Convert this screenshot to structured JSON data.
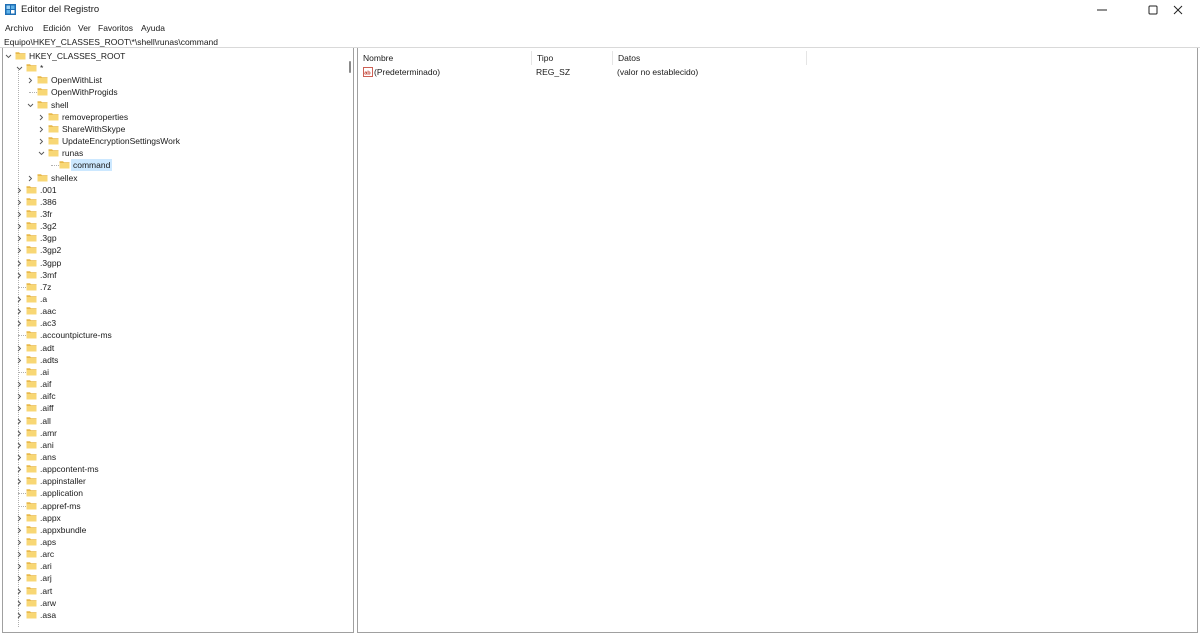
{
  "window": {
    "title": "Editor del Registro",
    "icon": "registry-editor-icon"
  },
  "menu": {
    "items": [
      "Archivo",
      "Edición",
      "Ver",
      "Favoritos",
      "Ayuda"
    ]
  },
  "address": {
    "path": "Equipo\\HKEY_CLASSES_ROOT\\*\\shell\\runas\\command"
  },
  "tree": {
    "rows": [
      {
        "label": "HKEY_CLASSES_ROOT",
        "level": 0,
        "state": "expanded"
      },
      {
        "label": "*",
        "level": 1,
        "state": "expanded"
      },
      {
        "label": "OpenWithList",
        "level": 2,
        "state": "collapsed"
      },
      {
        "label": "OpenWithProgids",
        "level": 2,
        "state": "leaf"
      },
      {
        "label": "shell",
        "level": 2,
        "state": "expanded"
      },
      {
        "label": "removeproperties",
        "level": 3,
        "state": "collapsed"
      },
      {
        "label": "ShareWithSkype",
        "level": 3,
        "state": "collapsed"
      },
      {
        "label": "UpdateEncryptionSettingsWork",
        "level": 3,
        "state": "collapsed"
      },
      {
        "label": "runas",
        "level": 3,
        "state": "expanded"
      },
      {
        "label": "command",
        "level": 4,
        "state": "selected"
      },
      {
        "label": "shellex",
        "level": 2,
        "state": "collapsed"
      },
      {
        "label": ".001",
        "level": 1,
        "state": "collapsed"
      },
      {
        "label": ".386",
        "level": 1,
        "state": "collapsed"
      },
      {
        "label": ".3fr",
        "level": 1,
        "state": "collapsed"
      },
      {
        "label": ".3g2",
        "level": 1,
        "state": "collapsed"
      },
      {
        "label": ".3gp",
        "level": 1,
        "state": "collapsed"
      },
      {
        "label": ".3gp2",
        "level": 1,
        "state": "collapsed"
      },
      {
        "label": ".3gpp",
        "level": 1,
        "state": "collapsed"
      },
      {
        "label": ".3mf",
        "level": 1,
        "state": "collapsed"
      },
      {
        "label": ".7z",
        "level": 1,
        "state": "leaf"
      },
      {
        "label": ".a",
        "level": 1,
        "state": "collapsed"
      },
      {
        "label": ".aac",
        "level": 1,
        "state": "collapsed"
      },
      {
        "label": ".ac3",
        "level": 1,
        "state": "collapsed"
      },
      {
        "label": ".accountpicture-ms",
        "level": 1,
        "state": "leaf"
      },
      {
        "label": ".adt",
        "level": 1,
        "state": "collapsed"
      },
      {
        "label": ".adts",
        "level": 1,
        "state": "collapsed"
      },
      {
        "label": ".ai",
        "level": 1,
        "state": "leaf"
      },
      {
        "label": ".aif",
        "level": 1,
        "state": "collapsed"
      },
      {
        "label": ".aifc",
        "level": 1,
        "state": "collapsed"
      },
      {
        "label": ".aiff",
        "level": 1,
        "state": "collapsed"
      },
      {
        "label": ".all",
        "level": 1,
        "state": "collapsed"
      },
      {
        "label": ".amr",
        "level": 1,
        "state": "collapsed"
      },
      {
        "label": ".ani",
        "level": 1,
        "state": "collapsed"
      },
      {
        "label": ".ans",
        "level": 1,
        "state": "collapsed"
      },
      {
        "label": ".appcontent-ms",
        "level": 1,
        "state": "collapsed"
      },
      {
        "label": ".appinstaller",
        "level": 1,
        "state": "collapsed"
      },
      {
        "label": ".application",
        "level": 1,
        "state": "leaf"
      },
      {
        "label": ".appref-ms",
        "level": 1,
        "state": "leaf"
      },
      {
        "label": ".appx",
        "level": 1,
        "state": "collapsed"
      },
      {
        "label": ".appxbundle",
        "level": 1,
        "state": "collapsed"
      },
      {
        "label": ".aps",
        "level": 1,
        "state": "collapsed"
      },
      {
        "label": ".arc",
        "level": 1,
        "state": "collapsed"
      },
      {
        "label": ".ari",
        "level": 1,
        "state": "collapsed"
      },
      {
        "label": ".arj",
        "level": 1,
        "state": "collapsed"
      },
      {
        "label": ".art",
        "level": 1,
        "state": "collapsed"
      },
      {
        "label": ".arw",
        "level": 1,
        "state": "collapsed"
      },
      {
        "label": ".asa",
        "level": 1,
        "state": "collapsed"
      }
    ]
  },
  "list": {
    "columns": [
      "Nombre",
      "Tipo",
      "Datos"
    ],
    "rows": [
      {
        "name": "(Predeterminado)",
        "type": "REG_SZ",
        "data": "(valor no establecido)"
      }
    ]
  },
  "colors": {
    "folder": "#f8d775",
    "folder_dark": "#e8b84a",
    "selection": "#cce8ff",
    "border": "#a0a0a0"
  }
}
